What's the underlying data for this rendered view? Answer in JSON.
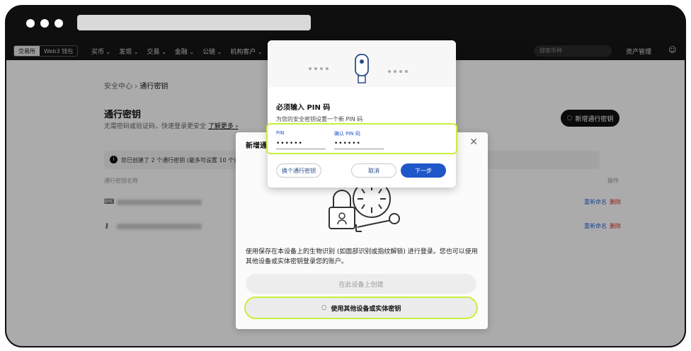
{
  "nav": {
    "seg_exchange": "交易所",
    "seg_wallet": "Web3 钱包",
    "menu": [
      "买币",
      "发现",
      "交易",
      "金融",
      "公链",
      "机构客户"
    ],
    "search_placeholder": "搜索币种",
    "assets": "资产管理"
  },
  "page": {
    "breadcrumb_parent": "安全中心",
    "breadcrumb_sep": "›",
    "breadcrumb_current": "通行密钥",
    "title": "通行密钥",
    "subtitle": "无需密码或验证码，快速登录更安全",
    "learn_more": "了解更多 ›",
    "add_button": "新增通行密钥",
    "notice": "您已创建了 2 个通行密钥 (最多可设置 10 个)，您可",
    "col_name": "通行密钥名称",
    "col_op": "操作",
    "rows": [
      {
        "rename": "重新命名",
        "delete": "删除"
      },
      {
        "rename": "重新命名",
        "delete": "删除"
      }
    ]
  },
  "modal": {
    "title": "新增通",
    "close": "✕",
    "description": "使用保存在本设备上的生物识别 (如面部识别或指纹解锁) 进行登录。您也可以使用其他设备或实体密钥登录您的账户。",
    "btn_create": "在此设备上创建",
    "btn_other": "使用其他设备或实体密钥"
  },
  "pin_dialog": {
    "title": "必须输入 PIN 码",
    "subtitle": "为您的安全密钥设置一个新 PIN 码",
    "pin_label": "PIN",
    "confirm_label": "确认 PIN 码",
    "pin_value": "••••••",
    "confirm_value": "••••••",
    "btn_other_key": "换个通行密钥",
    "btn_cancel": "取消",
    "btn_next": "下一步"
  },
  "colors": {
    "highlight": "#c8ef3d",
    "primary_blue": "#1f56c9"
  }
}
